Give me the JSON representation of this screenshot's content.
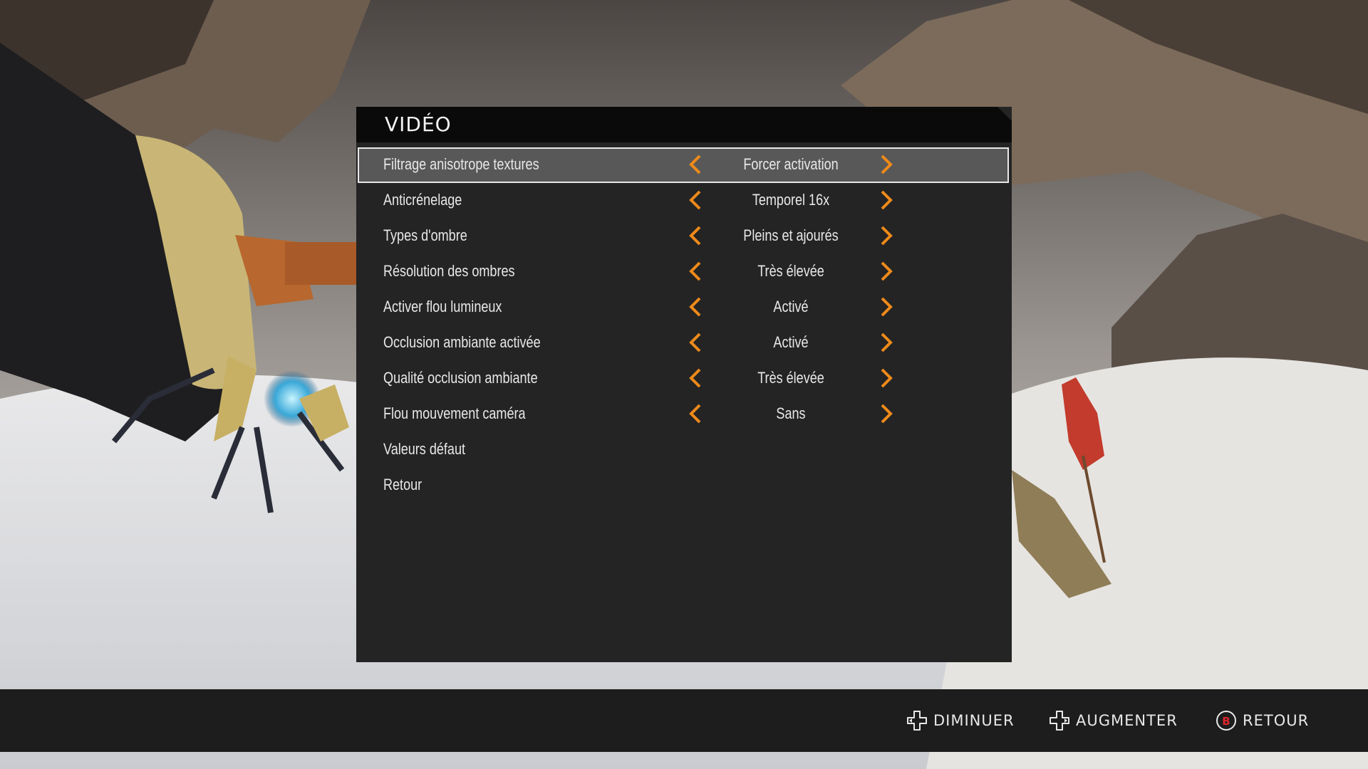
{
  "menu": {
    "title": "VIDÉO",
    "settings": [
      {
        "label": "Filtrage anisotrope textures",
        "value": "Forcer activation",
        "selected": true
      },
      {
        "label": "Anticrénelage",
        "value": "Temporel 16x"
      },
      {
        "label": "Types d'ombre",
        "value": "Pleins et ajourés"
      },
      {
        "label": "Résolution des ombres",
        "value": "Très élevée"
      },
      {
        "label": "Activer flou lumineux",
        "value": "Activé"
      },
      {
        "label": "Occlusion ambiante activée",
        "value": "Activé"
      },
      {
        "label": "Qualité occlusion ambiante",
        "value": "Très élevée"
      },
      {
        "label": "Flou mouvement caméra",
        "value": "Sans"
      }
    ],
    "actions": [
      {
        "label": "Valeurs défaut"
      },
      {
        "label": "Retour"
      }
    ]
  },
  "footer": {
    "decrease": {
      "label": "DIMINUER",
      "icon": "dpad-icon"
    },
    "increase": {
      "label": "AUGMENTER",
      "icon": "dpad-icon"
    },
    "back": {
      "label": "RETOUR",
      "icon": "b-button-icon",
      "button_letter": "B",
      "button_color": "#e0242b"
    }
  },
  "colors": {
    "accent": "#f08a1a",
    "panel": "#242424",
    "header": "#0a0a0a",
    "selected_row": "#585858",
    "text": "#e8e8e8"
  }
}
